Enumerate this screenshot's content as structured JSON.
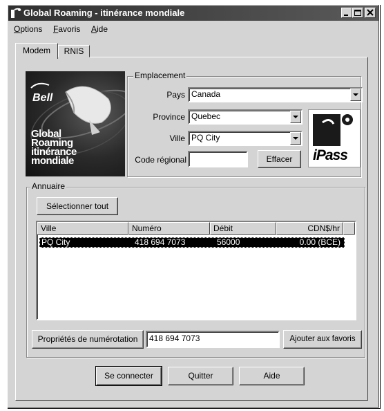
{
  "window": {
    "title": "Global Roaming - itinérance mondiale",
    "controls": [
      "minimize",
      "maximize",
      "close"
    ]
  },
  "menu": [
    {
      "label": "Options",
      "accel": "O",
      "rest": "ptions"
    },
    {
      "label": "Favoris",
      "accel": "F",
      "rest": "avoris"
    },
    {
      "label": "Aide",
      "accel": "A",
      "rest": "ide"
    }
  ],
  "tabs": [
    {
      "label": "Modem",
      "active": true
    },
    {
      "label": "RNIS",
      "active": false
    }
  ],
  "branding": {
    "bell_logo_text": "Bell",
    "image_caption_lines": [
      "Global",
      "Roaming",
      "itinérance",
      "mondiale"
    ],
    "ipass_logo_text": "iPass"
  },
  "location": {
    "legend": "Emplacement",
    "country_label": "Pays",
    "country_value": "Canada",
    "province_label": "Province",
    "province_value": "Quebec",
    "city_label": "Ville",
    "city_value": "PQ City",
    "area_code_label": "Code régional",
    "area_code_value": "",
    "clear_button": "Effacer"
  },
  "directory": {
    "legend": "Annuaire",
    "select_all_button": "Sélectionner tout",
    "columns": [
      "Ville",
      "Numéro",
      "Débit",
      "CDN$/hr"
    ],
    "rows": [
      {
        "city": "PQ City",
        "number": "418 694 7073",
        "speed": "56000",
        "rate": "0.00 (BCE)",
        "selected": true
      }
    ],
    "dialing_properties_button": "Propriétés de numérotation",
    "phone_number_value": "418 694 7073",
    "add_favorites_button": "Ajouter aux favoris"
  },
  "actions": {
    "connect": "Se connecter",
    "quit": "Quitter",
    "help": "Aide"
  },
  "colors": {
    "dialog_face": "#d4d4d4",
    "title_bar": "#303030",
    "selection": "#000000"
  }
}
